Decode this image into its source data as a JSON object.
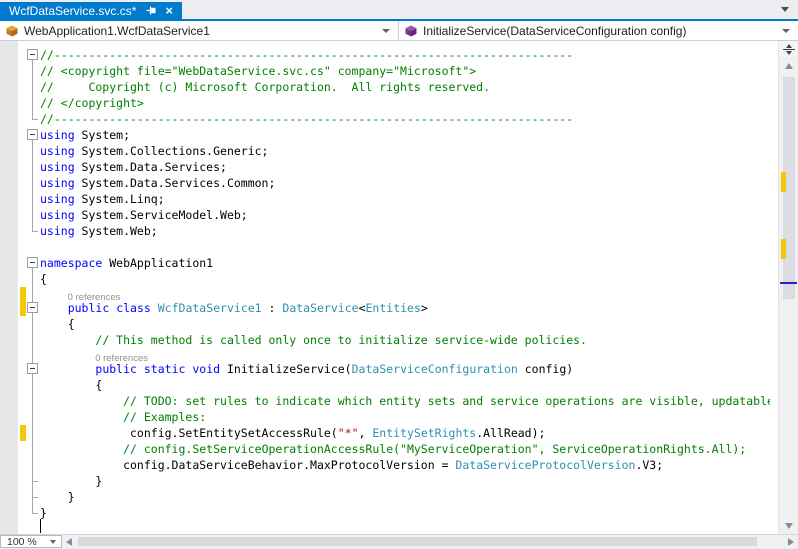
{
  "tab": {
    "title": "WcfDataService.svc.cs*"
  },
  "navbar": {
    "type_selector": "WebApplication1.WcfDataService1",
    "member_selector": "InitializeService(DataServiceConfiguration config)"
  },
  "statusbar": {
    "zoom_label": "100 %"
  },
  "colors": {
    "accent_blue": "#007acc",
    "keyword": "#0000ff",
    "type": "#2b91af",
    "comment": "#008000",
    "string": "#a31515",
    "change_track_yellow": "#f2c80a",
    "codelens_gray": "#8f8f8f"
  },
  "editor": {
    "lines": [
      {
        "kind": "code",
        "fold": true,
        "tokens": [
          [
            "c",
            "//---------------------------------------------------------------------------"
          ]
        ]
      },
      {
        "kind": "code",
        "tokens": [
          [
            "c",
            "// <copyright file=\"WebDataService.svc.cs\" company=\"Microsoft\">"
          ]
        ]
      },
      {
        "kind": "code",
        "tokens": [
          [
            "c",
            "//     Copyright (c) Microsoft Corporation.  All rights reserved."
          ]
        ]
      },
      {
        "kind": "code",
        "tokens": [
          [
            "c",
            "// </copyright>"
          ]
        ]
      },
      {
        "kind": "code",
        "tick": true,
        "tokens": [
          [
            "c",
            "//---------------------------------------------------------------------------"
          ]
        ]
      },
      {
        "kind": "code",
        "fold": true,
        "tokens": [
          [
            "k",
            "using"
          ],
          [
            "p",
            " System;"
          ]
        ]
      },
      {
        "kind": "code",
        "tokens": [
          [
            "k",
            "using"
          ],
          [
            "p",
            " System.Collections.Generic;"
          ]
        ]
      },
      {
        "kind": "code",
        "tokens": [
          [
            "k",
            "using"
          ],
          [
            "p",
            " System.Data.Services;"
          ]
        ]
      },
      {
        "kind": "code",
        "tokens": [
          [
            "k",
            "using"
          ],
          [
            "p",
            " System.Data.Services.Common;"
          ]
        ]
      },
      {
        "kind": "code",
        "tokens": [
          [
            "k",
            "using"
          ],
          [
            "p",
            " System.Linq;"
          ]
        ]
      },
      {
        "kind": "code",
        "tokens": [
          [
            "k",
            "using"
          ],
          [
            "p",
            " System.ServiceModel.Web;"
          ]
        ]
      },
      {
        "kind": "code",
        "tick": true,
        "tokens": [
          [
            "k",
            "using"
          ],
          [
            "p",
            " System.Web;"
          ]
        ]
      },
      {
        "kind": "blank"
      },
      {
        "kind": "code",
        "fold": true,
        "tokens": [
          [
            "k",
            "namespace"
          ],
          [
            "p",
            " WebApplication1"
          ]
        ]
      },
      {
        "kind": "code",
        "tokens": [
          [
            "p",
            "{"
          ]
        ]
      },
      {
        "kind": "lens",
        "col": 4,
        "changed": true,
        "text": "0 references"
      },
      {
        "kind": "code",
        "fold": true,
        "changed": true,
        "tokens": [
          [
            "p",
            "    "
          ],
          [
            "k",
            "public"
          ],
          [
            "p",
            " "
          ],
          [
            "k",
            "class"
          ],
          [
            "p",
            " "
          ],
          [
            "t",
            "WcfDataService1"
          ],
          [
            "p",
            " : "
          ],
          [
            "t",
            "DataService"
          ],
          [
            "p",
            "<"
          ],
          [
            "t",
            "Entities"
          ],
          [
            "p",
            ">"
          ]
        ]
      },
      {
        "kind": "code",
        "tokens": [
          [
            "p",
            "    {"
          ]
        ]
      },
      {
        "kind": "code",
        "tokens": [
          [
            "p",
            "        "
          ],
          [
            "c",
            "// This method is called only once to initialize service-wide policies."
          ]
        ]
      },
      {
        "kind": "lens",
        "col": 8,
        "text": "0 references"
      },
      {
        "kind": "code",
        "fold": true,
        "tokens": [
          [
            "p",
            "        "
          ],
          [
            "k",
            "public"
          ],
          [
            "p",
            " "
          ],
          [
            "k",
            "static"
          ],
          [
            "p",
            " "
          ],
          [
            "k",
            "void"
          ],
          [
            "p",
            " InitializeService("
          ],
          [
            "t",
            "DataServiceConfiguration"
          ],
          [
            "p",
            " config)"
          ]
        ]
      },
      {
        "kind": "code",
        "tokens": [
          [
            "p",
            "        {"
          ]
        ]
      },
      {
        "kind": "code",
        "tokens": [
          [
            "p",
            "            "
          ],
          [
            "c",
            "// TODO: set rules to indicate which entity sets and service operations are visible, updatable"
          ]
        ]
      },
      {
        "kind": "code",
        "tokens": [
          [
            "p",
            "            "
          ],
          [
            "c",
            "// Examples:"
          ]
        ]
      },
      {
        "kind": "code",
        "changed": true,
        "tokens": [
          [
            "p",
            "             config.SetEntitySetAccessRule("
          ],
          [
            "s",
            "\"*\""
          ],
          [
            "p",
            ", "
          ],
          [
            "t",
            "EntitySetRights"
          ],
          [
            "p",
            ".AllRead);"
          ]
        ]
      },
      {
        "kind": "code",
        "tokens": [
          [
            "p",
            "            "
          ],
          [
            "c",
            "// config.SetServiceOperationAccessRule(\"MyServiceOperation\", ServiceOperationRights.All);"
          ]
        ]
      },
      {
        "kind": "code",
        "tokens": [
          [
            "p",
            "            config.DataServiceBehavior.MaxProtocolVersion = "
          ],
          [
            "t",
            "DataServiceProtocolVersion"
          ],
          [
            "p",
            ".V3;"
          ]
        ]
      },
      {
        "kind": "code",
        "tick": true,
        "tokens": [
          [
            "p",
            "        }"
          ]
        ]
      },
      {
        "kind": "code",
        "tick": true,
        "tokens": [
          [
            "p",
            "    }"
          ]
        ]
      },
      {
        "kind": "code",
        "tick": true,
        "tokens": [
          [
            "p",
            "}"
          ]
        ]
      },
      {
        "kind": "blank"
      }
    ]
  }
}
